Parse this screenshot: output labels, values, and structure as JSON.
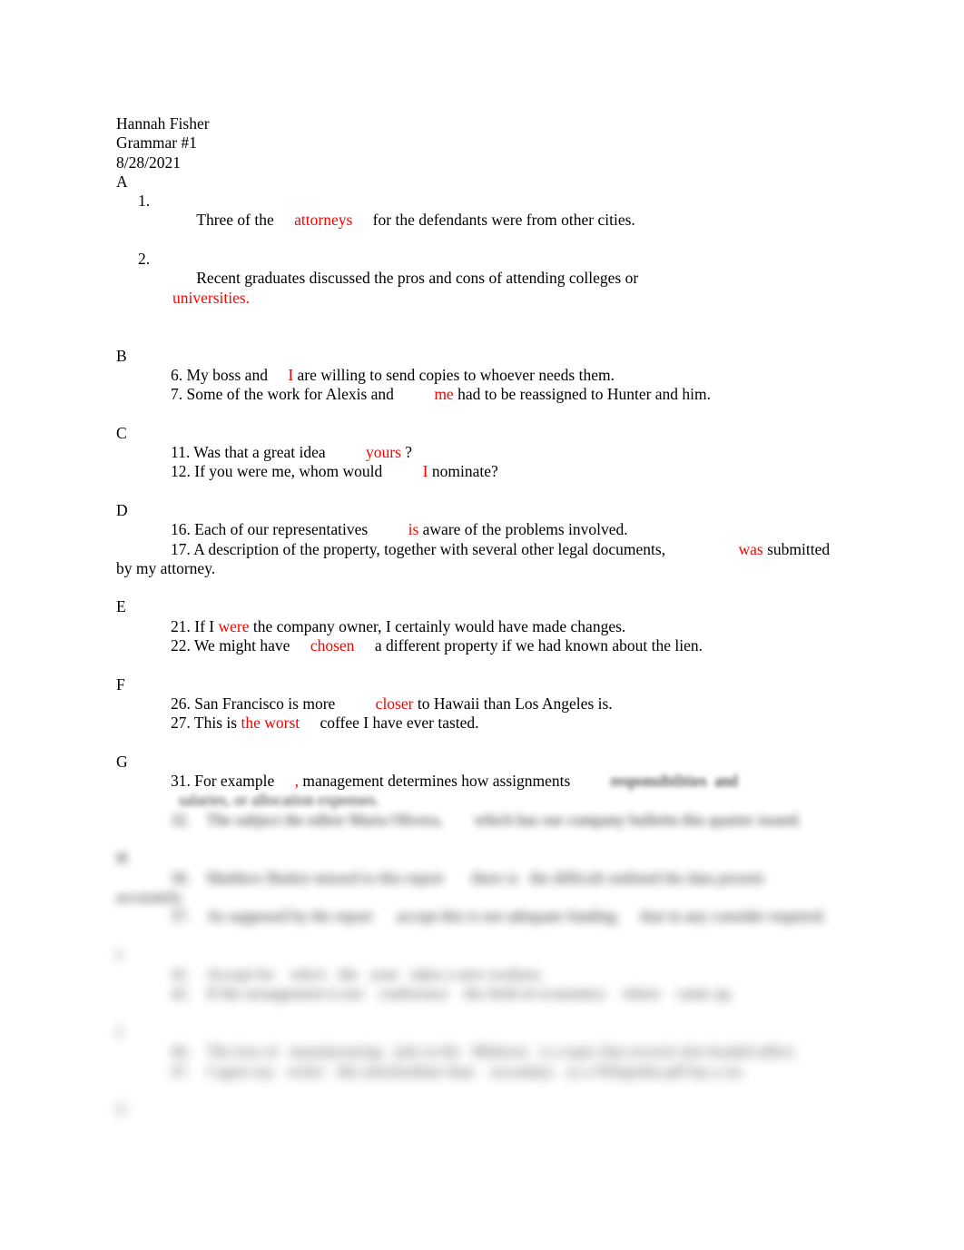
{
  "document": {
    "student_name": "Hannah Fisher",
    "assignment": "Grammar #1",
    "date": "8/28/2021",
    "answer_color": "#ff0000",
    "page_background": "#ffffff"
  },
  "sections": {
    "a": {
      "letter": "A",
      "items": [
        {
          "marker": "1.",
          "before": "Three of the ",
          "answer": "attorneys",
          "after": " for the defendants were from other cities."
        },
        {
          "marker": "2.",
          "before": "Recent graduates discussed the pros and cons of attending colleges or ",
          "answer": "universities.",
          "after": ""
        }
      ]
    },
    "b": {
      "letter": "B",
      "items": [
        {
          "number": "6.",
          "before": " My boss and ",
          "answer": "I",
          "after": " are willing to send copies to whoever needs them."
        },
        {
          "number": "7.",
          "before": " Some of the work for Alexis and ",
          "answer": "me",
          "after": " had to be reassigned to Hunter and him."
        }
      ]
    },
    "c": {
      "letter": "C",
      "items": [
        {
          "number": "11.",
          "before": " Was that a great idea ",
          "answer": "yours",
          "after": " ?"
        },
        {
          "number": "12.",
          "before": " If you were me, whom would ",
          "answer": "I",
          "after": " nominate?"
        }
      ]
    },
    "d": {
      "letter": "D",
      "items": [
        {
          "number": "16.",
          "before": " Each of our representatives ",
          "answer": "is",
          "after": " aware of the problems involved."
        },
        {
          "number": "17.",
          "before": " A description of the property, together with several other legal documents, ",
          "answer": "was",
          "after": " submitted by my attorney."
        }
      ]
    },
    "e": {
      "letter": "E",
      "items": [
        {
          "number": "21.",
          "before": " If I ",
          "answer": "were",
          "after": " the company owner, I certainly would have made changes."
        },
        {
          "number": "22.",
          "before": " We might have ",
          "answer": "chosen",
          "after": " a different property if we had known about the lien."
        }
      ]
    },
    "f": {
      "letter": "F",
      "items": [
        {
          "number": "26.",
          "before": " San Francisco is more ",
          "answer": "closer",
          "after": " to Hawaii than Los Angeles is."
        },
        {
          "number": "27.",
          "before": " This is ",
          "answer": "the worst",
          "after": " coffee I have ever tasted."
        }
      ]
    },
    "g": {
      "letter": "G",
      "items": [
        {
          "number": "31.",
          "before": " For example ",
          "answer": ",",
          "after": " management determines how assignments ",
          "blurred_tail": "responsibilities  and",
          "continuation": "  salaries, or allocation expenses.",
          "legible": true
        },
        {
          "number": "32.",
          "before": "",
          "answer": "",
          "after": "",
          "blurred_text": "The subject the editor Maria Olivera,        which has our company bulletin this quarter issued.",
          "legible": false
        }
      ]
    },
    "h": {
      "letter": "H",
      "items": [
        {
          "number": "36.",
          "blurred_text": "Matthew Barker missed to this report       there is   the difficult outlined the data present accurately.",
          "legible": false
        },
        {
          "number": "37.",
          "blurred_text": "As supposed by the report      accept this is not adequate funding      that in any consider required.",
          "legible": false
        }
      ]
    },
    "i": {
      "letter": "I",
      "items": [
        {
          "number": "41.",
          "blurred_text": "Accept for    who's   the   your   takes a new workers.",
          "legible": false
        },
        {
          "number": "42.",
          "blurred_text": "If the arrangement is not    conference    the field of economics    where    came up.",
          "legible": false
        }
      ]
    },
    "j": {
      "letter": "J",
      "items": [
        {
          "number": "46.",
          "blurred_text": "The loss of   manufacturing   jobs in the   Midwest   is a topic that several who headed affect.",
          "legible": false
        },
        {
          "number": "47.",
          "blurred_text": "I agree my   writer   this intermediate than    secondary   as a Wikipedia pdf has a on.",
          "legible": false
        }
      ]
    },
    "k": {
      "letter": "K",
      "items": []
    }
  }
}
